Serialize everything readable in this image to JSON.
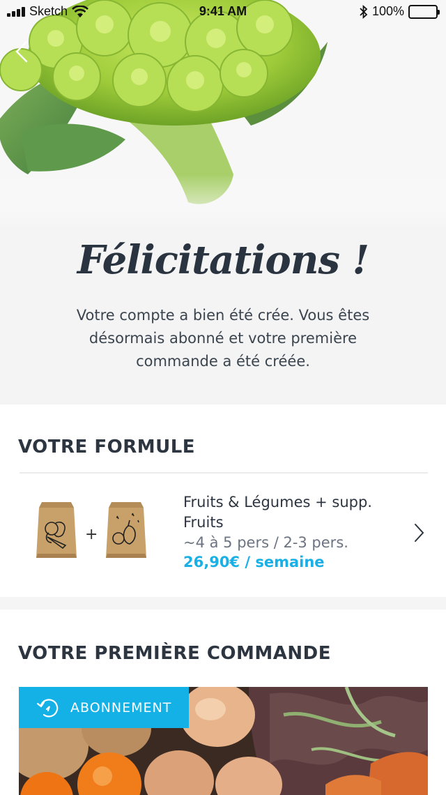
{
  "status_bar": {
    "carrier": "Sketch",
    "time": "9:41 AM",
    "battery": "100%",
    "battery_level": 1.0
  },
  "header": {
    "title": "Félicitations !",
    "message": "Votre compte a bien été crée. Vous êtes désormais abonné et votre première commande a été créée."
  },
  "formule": {
    "section_title": "VOTRE FORMULE",
    "plus": "+",
    "plan_name": "Fruits & Légumes + supp. Fruits",
    "persons": "~4 à 5 pers / 2-3 pers.",
    "price": "26,90€ / semaine"
  },
  "commande": {
    "section_title": "VOTRE PREMIÈRE COMMANDE",
    "badge_label": "ABONNEMENT"
  },
  "colors": {
    "accent": "#1ab0e6",
    "badge": "#14b1e7",
    "title": "#2a3440"
  },
  "icons": [
    "back-chevron-icon",
    "signal-icon",
    "wifi-icon",
    "bluetooth-icon",
    "battery-icon",
    "chevron-right-icon",
    "subscription-refresh-icon"
  ]
}
